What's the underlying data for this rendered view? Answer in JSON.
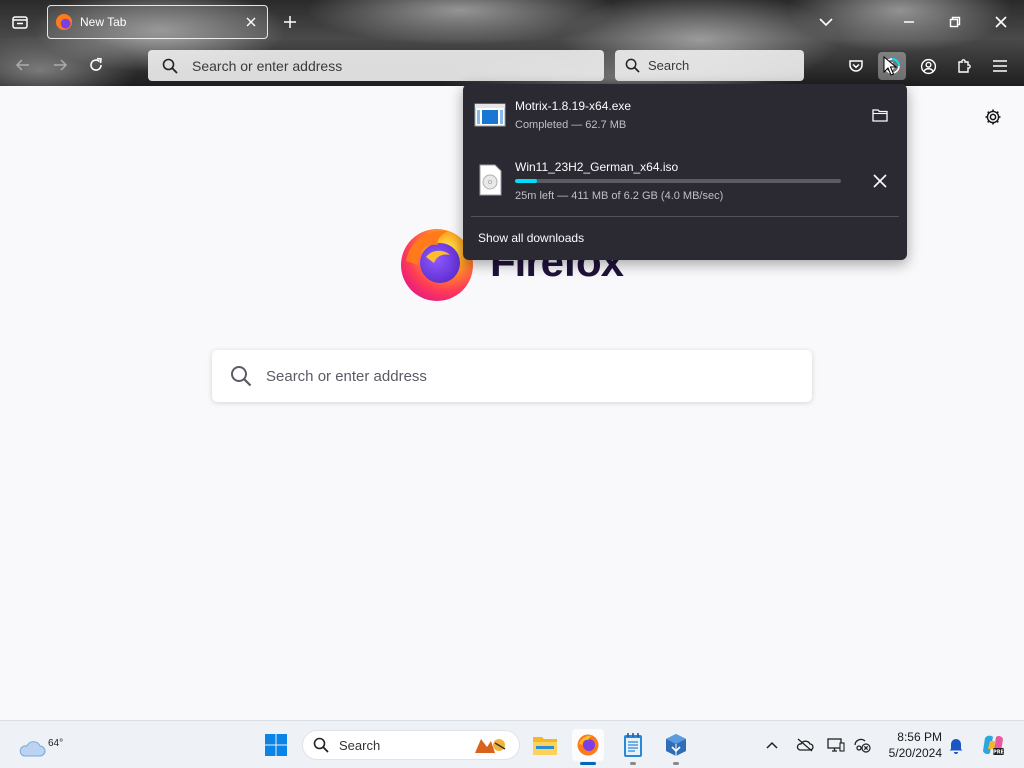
{
  "browser": {
    "tab": {
      "title": "New Tab"
    },
    "urlbar": {
      "placeholder": "Search or enter address"
    },
    "searchbar": {
      "placeholder": "Search"
    }
  },
  "newtab": {
    "wordmark": "Firefox",
    "search_placeholder": "Search or enter address"
  },
  "downloads": {
    "items": [
      {
        "name": "Motrix-1.8.19-x64.exe",
        "status": "Completed — 62.7 MB",
        "action": "show-in-folder"
      },
      {
        "name": "Win11_23H2_German_x64.iso",
        "status": "25m left — 411 MB of 6.2 GB (4.0 MB/sec)",
        "progress": 0.066,
        "action": "cancel"
      }
    ],
    "show_all": "Show all downloads"
  },
  "taskbar": {
    "weather_temp": "64°",
    "search_label": "Search",
    "time": "8:56 PM",
    "date": "5/20/2024"
  },
  "colors": {
    "accent": "#00ddff",
    "panel_bg": "#2b2a33",
    "windows_blue": "#0067c0"
  }
}
